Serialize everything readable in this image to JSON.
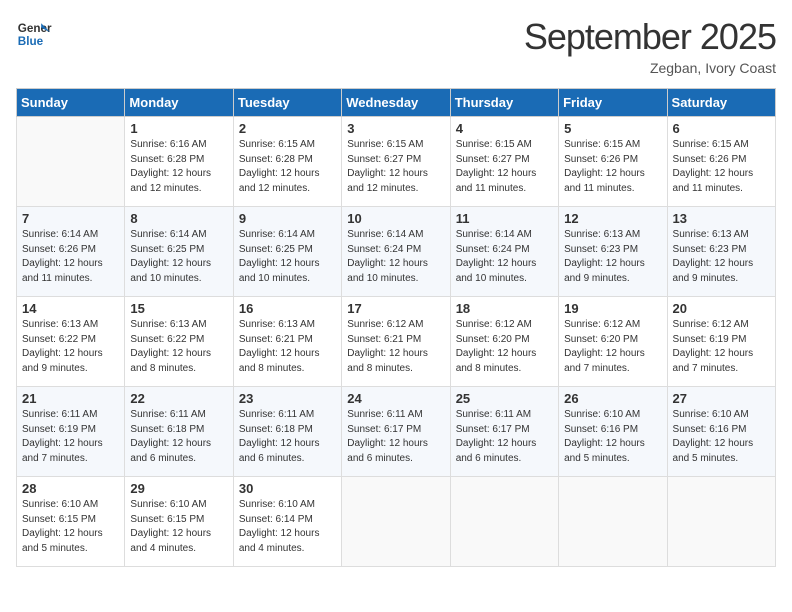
{
  "logo": {
    "line1": "General",
    "line2": "Blue"
  },
  "title": "September 2025",
  "subtitle": "Zegban, Ivory Coast",
  "headers": [
    "Sunday",
    "Monday",
    "Tuesday",
    "Wednesday",
    "Thursday",
    "Friday",
    "Saturday"
  ],
  "weeks": [
    [
      {
        "day": "",
        "info": ""
      },
      {
        "day": "1",
        "info": "Sunrise: 6:16 AM\nSunset: 6:28 PM\nDaylight: 12 hours\nand 12 minutes."
      },
      {
        "day": "2",
        "info": "Sunrise: 6:15 AM\nSunset: 6:28 PM\nDaylight: 12 hours\nand 12 minutes."
      },
      {
        "day": "3",
        "info": "Sunrise: 6:15 AM\nSunset: 6:27 PM\nDaylight: 12 hours\nand 12 minutes."
      },
      {
        "day": "4",
        "info": "Sunrise: 6:15 AM\nSunset: 6:27 PM\nDaylight: 12 hours\nand 11 minutes."
      },
      {
        "day": "5",
        "info": "Sunrise: 6:15 AM\nSunset: 6:26 PM\nDaylight: 12 hours\nand 11 minutes."
      },
      {
        "day": "6",
        "info": "Sunrise: 6:15 AM\nSunset: 6:26 PM\nDaylight: 12 hours\nand 11 minutes."
      }
    ],
    [
      {
        "day": "7",
        "info": "Sunrise: 6:14 AM\nSunset: 6:26 PM\nDaylight: 12 hours\nand 11 minutes."
      },
      {
        "day": "8",
        "info": "Sunrise: 6:14 AM\nSunset: 6:25 PM\nDaylight: 12 hours\nand 10 minutes."
      },
      {
        "day": "9",
        "info": "Sunrise: 6:14 AM\nSunset: 6:25 PM\nDaylight: 12 hours\nand 10 minutes."
      },
      {
        "day": "10",
        "info": "Sunrise: 6:14 AM\nSunset: 6:24 PM\nDaylight: 12 hours\nand 10 minutes."
      },
      {
        "day": "11",
        "info": "Sunrise: 6:14 AM\nSunset: 6:24 PM\nDaylight: 12 hours\nand 10 minutes."
      },
      {
        "day": "12",
        "info": "Sunrise: 6:13 AM\nSunset: 6:23 PM\nDaylight: 12 hours\nand 9 minutes."
      },
      {
        "day": "13",
        "info": "Sunrise: 6:13 AM\nSunset: 6:23 PM\nDaylight: 12 hours\nand 9 minutes."
      }
    ],
    [
      {
        "day": "14",
        "info": "Sunrise: 6:13 AM\nSunset: 6:22 PM\nDaylight: 12 hours\nand 9 minutes."
      },
      {
        "day": "15",
        "info": "Sunrise: 6:13 AM\nSunset: 6:22 PM\nDaylight: 12 hours\nand 8 minutes."
      },
      {
        "day": "16",
        "info": "Sunrise: 6:13 AM\nSunset: 6:21 PM\nDaylight: 12 hours\nand 8 minutes."
      },
      {
        "day": "17",
        "info": "Sunrise: 6:12 AM\nSunset: 6:21 PM\nDaylight: 12 hours\nand 8 minutes."
      },
      {
        "day": "18",
        "info": "Sunrise: 6:12 AM\nSunset: 6:20 PM\nDaylight: 12 hours\nand 8 minutes."
      },
      {
        "day": "19",
        "info": "Sunrise: 6:12 AM\nSunset: 6:20 PM\nDaylight: 12 hours\nand 7 minutes."
      },
      {
        "day": "20",
        "info": "Sunrise: 6:12 AM\nSunset: 6:19 PM\nDaylight: 12 hours\nand 7 minutes."
      }
    ],
    [
      {
        "day": "21",
        "info": "Sunrise: 6:11 AM\nSunset: 6:19 PM\nDaylight: 12 hours\nand 7 minutes."
      },
      {
        "day": "22",
        "info": "Sunrise: 6:11 AM\nSunset: 6:18 PM\nDaylight: 12 hours\nand 6 minutes."
      },
      {
        "day": "23",
        "info": "Sunrise: 6:11 AM\nSunset: 6:18 PM\nDaylight: 12 hours\nand 6 minutes."
      },
      {
        "day": "24",
        "info": "Sunrise: 6:11 AM\nSunset: 6:17 PM\nDaylight: 12 hours\nand 6 minutes."
      },
      {
        "day": "25",
        "info": "Sunrise: 6:11 AM\nSunset: 6:17 PM\nDaylight: 12 hours\nand 6 minutes."
      },
      {
        "day": "26",
        "info": "Sunrise: 6:10 AM\nSunset: 6:16 PM\nDaylight: 12 hours\nand 5 minutes."
      },
      {
        "day": "27",
        "info": "Sunrise: 6:10 AM\nSunset: 6:16 PM\nDaylight: 12 hours\nand 5 minutes."
      }
    ],
    [
      {
        "day": "28",
        "info": "Sunrise: 6:10 AM\nSunset: 6:15 PM\nDaylight: 12 hours\nand 5 minutes."
      },
      {
        "day": "29",
        "info": "Sunrise: 6:10 AM\nSunset: 6:15 PM\nDaylight: 12 hours\nand 4 minutes."
      },
      {
        "day": "30",
        "info": "Sunrise: 6:10 AM\nSunset: 6:14 PM\nDaylight: 12 hours\nand 4 minutes."
      },
      {
        "day": "",
        "info": ""
      },
      {
        "day": "",
        "info": ""
      },
      {
        "day": "",
        "info": ""
      },
      {
        "day": "",
        "info": ""
      }
    ]
  ]
}
